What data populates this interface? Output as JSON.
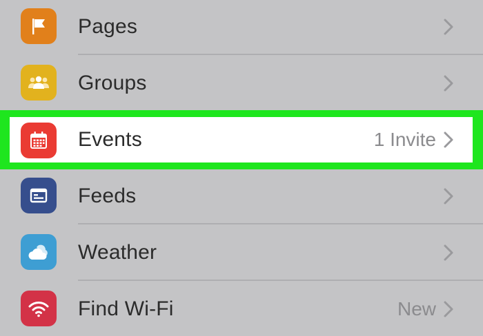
{
  "menu": {
    "items": [
      {
        "id": "pages",
        "label": "Pages",
        "detail": "",
        "icon": "flag-icon",
        "color": "#e1801b"
      },
      {
        "id": "groups",
        "label": "Groups",
        "detail": "",
        "icon": "people-icon",
        "color": "#e2b21e"
      },
      {
        "id": "events",
        "label": "Events",
        "detail": "1 Invite",
        "icon": "calendar-icon",
        "color": "#ea3b33"
      },
      {
        "id": "feeds",
        "label": "Feeds",
        "detail": "",
        "icon": "feed-icon",
        "color": "#364e8d"
      },
      {
        "id": "weather",
        "label": "Weather",
        "detail": "",
        "icon": "weather-icon",
        "color": "#3e9ed3"
      },
      {
        "id": "wifi",
        "label": "Find Wi-Fi",
        "detail": "New",
        "icon": "wifi-icon",
        "color": "#d33247"
      }
    ]
  },
  "colors": {
    "highlight": "#1ee61e",
    "background": "#c4c4c6",
    "chevron": "#9a9a9d"
  }
}
